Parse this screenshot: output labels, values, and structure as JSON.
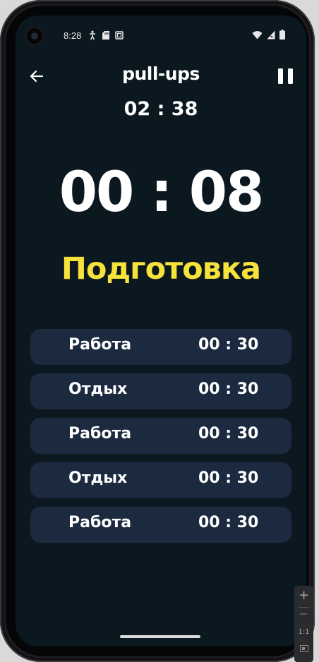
{
  "status_bar": {
    "time": "8:28",
    "left_icons": [
      "accessibility-icon",
      "sd-card-icon",
      "screenshot-icon"
    ],
    "right_icons": [
      "wifi-icon",
      "signal-icon",
      "battery-icon"
    ]
  },
  "header": {
    "title": "pull-ups",
    "back_icon": "arrow-left-icon",
    "pause_icon": "pause-icon"
  },
  "timers": {
    "total_remaining": "02 : 38",
    "current": "00 : 08",
    "phase": "Подготовка"
  },
  "intervals": [
    {
      "name": "Работа",
      "time": "00 : 30"
    },
    {
      "name": "Отдых",
      "time": "00 : 30"
    },
    {
      "name": "Работа",
      "time": "00 : 30"
    },
    {
      "name": "Отдых",
      "time": "00 : 30"
    },
    {
      "name": "Работа",
      "time": "00 : 30"
    }
  ],
  "emulator_controls": {
    "zoom_in": "+",
    "zoom_out": "−",
    "one_to_one": "1:1"
  },
  "colors": {
    "background": "#0b1820",
    "card": "#1c2a40",
    "phase_accent": "#f6e23a",
    "text": "#ffffff"
  }
}
